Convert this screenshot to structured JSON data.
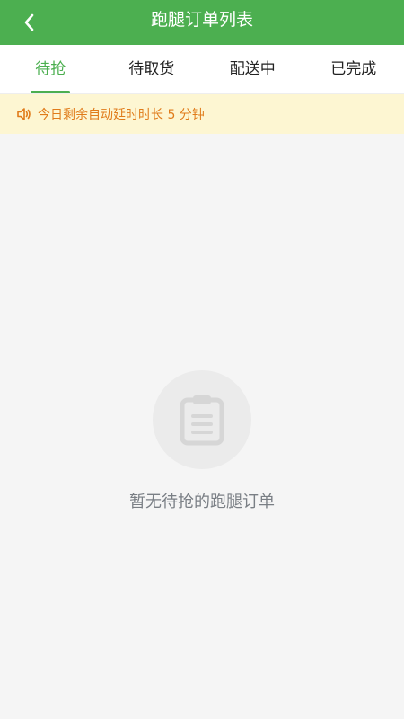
{
  "header": {
    "title": "跑腿订单列表",
    "back_icon": "chevron-left-icon"
  },
  "tabs": [
    {
      "label": "待抢",
      "active": true
    },
    {
      "label": "待取货",
      "active": false
    },
    {
      "label": "配送中",
      "active": false
    },
    {
      "label": "已完成",
      "active": false
    }
  ],
  "notice": {
    "icon": "speaker-icon",
    "text": "今日剩余自动延时时长 5 分钟"
  },
  "empty_state": {
    "icon": "clipboard-icon",
    "text": "暂无待抢的跑腿订单"
  },
  "colors": {
    "primary": "#4caf50",
    "notice_bg": "#fdf6d2",
    "notice_text": "#e07b1a",
    "background": "#f5f5f5"
  }
}
